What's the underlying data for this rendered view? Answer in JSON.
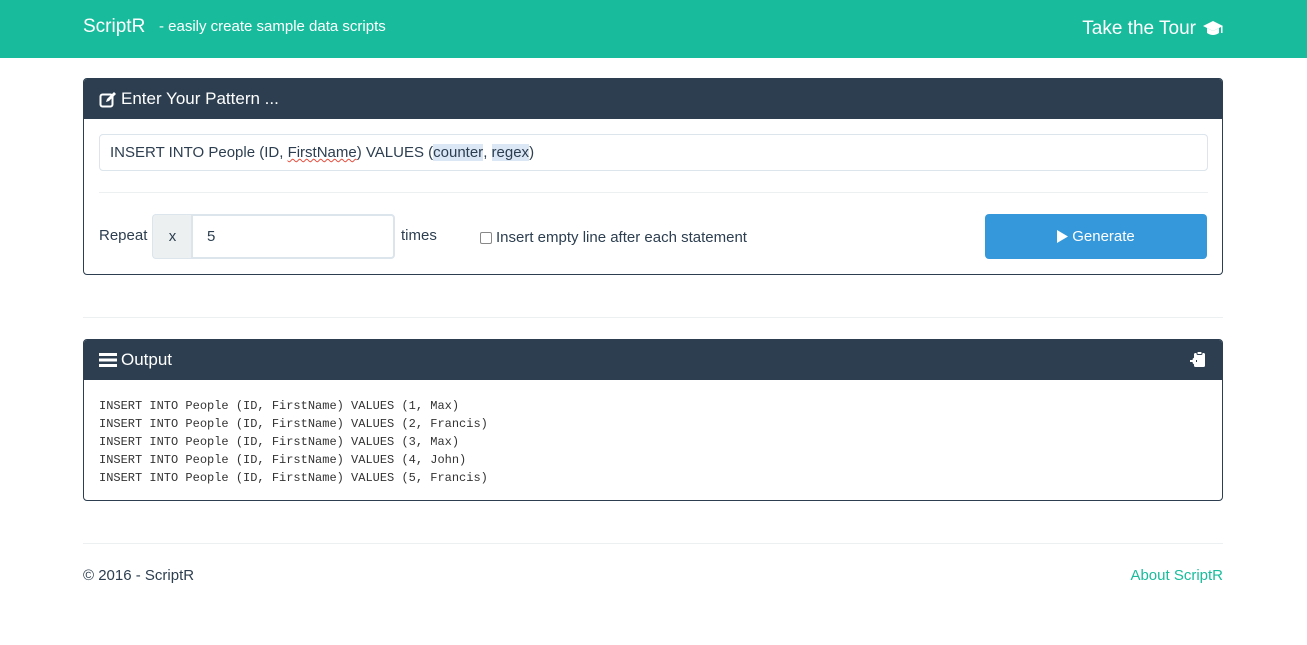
{
  "navbar": {
    "brand": "ScriptR",
    "tagline": "- easily create sample data scripts",
    "tour_label": "Take the Tour"
  },
  "pattern_panel": {
    "title": "Enter Your Pattern ...",
    "pattern": {
      "part1": "INSERT INTO People (ID, ",
      "part2": "FirstName",
      "part3": ") VALUES (",
      "part4": "counter",
      "part5": ", ",
      "part6": "regex",
      "part7": ")"
    },
    "repeat_label": "Repeat",
    "addon": "x",
    "repeat_count": "5",
    "times_label": "times",
    "checkbox_label": "Insert empty line after each statement",
    "checkbox_checked": false,
    "generate_label": "Generate"
  },
  "output_panel": {
    "title": "Output",
    "lines": [
      "INSERT INTO People (ID, FirstName) VALUES (1, Max)",
      "INSERT INTO People (ID, FirstName) VALUES (2, Francis)",
      "INSERT INTO People (ID, FirstName) VALUES (3, Max)",
      "INSERT INTO People (ID, FirstName) VALUES (4, John)",
      "INSERT INTO People (ID, FirstName) VALUES (5, Francis)"
    ]
  },
  "footer": {
    "copyright": "© 2016 - ScriptR",
    "about_link": "About ScriptR"
  },
  "colors": {
    "brand": "#18bc9c",
    "panel_header": "#2c3e50",
    "primary_button": "#3498db"
  },
  "icons": {
    "tour": "graduation-cap-icon",
    "pattern": "edit-icon",
    "generate": "play-icon",
    "output": "list-icon",
    "copy": "clipboard-icon"
  }
}
